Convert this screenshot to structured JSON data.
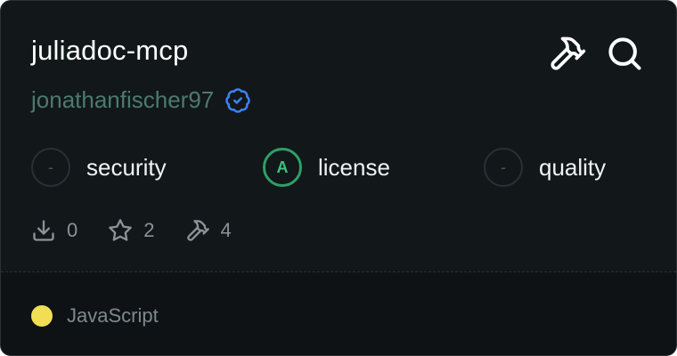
{
  "card": {
    "title": "juliadoc-mcp",
    "author": "jonathanfischer97",
    "verified_icon": "verified-badge-icon",
    "actions": [
      {
        "name": "hammer-icon"
      },
      {
        "name": "search-icon"
      }
    ],
    "badges": [
      {
        "grade": "-",
        "label": "security"
      },
      {
        "grade": "A",
        "label": "license"
      },
      {
        "grade": "-",
        "label": "quality"
      }
    ],
    "stats": [
      {
        "icon": "download-icon",
        "value": "0"
      },
      {
        "icon": "star-icon",
        "value": "2"
      },
      {
        "icon": "hammer-icon",
        "value": "4"
      }
    ],
    "language": {
      "name": "JavaScript",
      "color": "#f1de55"
    }
  },
  "colors": {
    "background": "#121719",
    "footer": "#0e1214",
    "grade_a": "#2f9e69",
    "author": "#4c7a6c",
    "verified": "#3b82f6"
  }
}
